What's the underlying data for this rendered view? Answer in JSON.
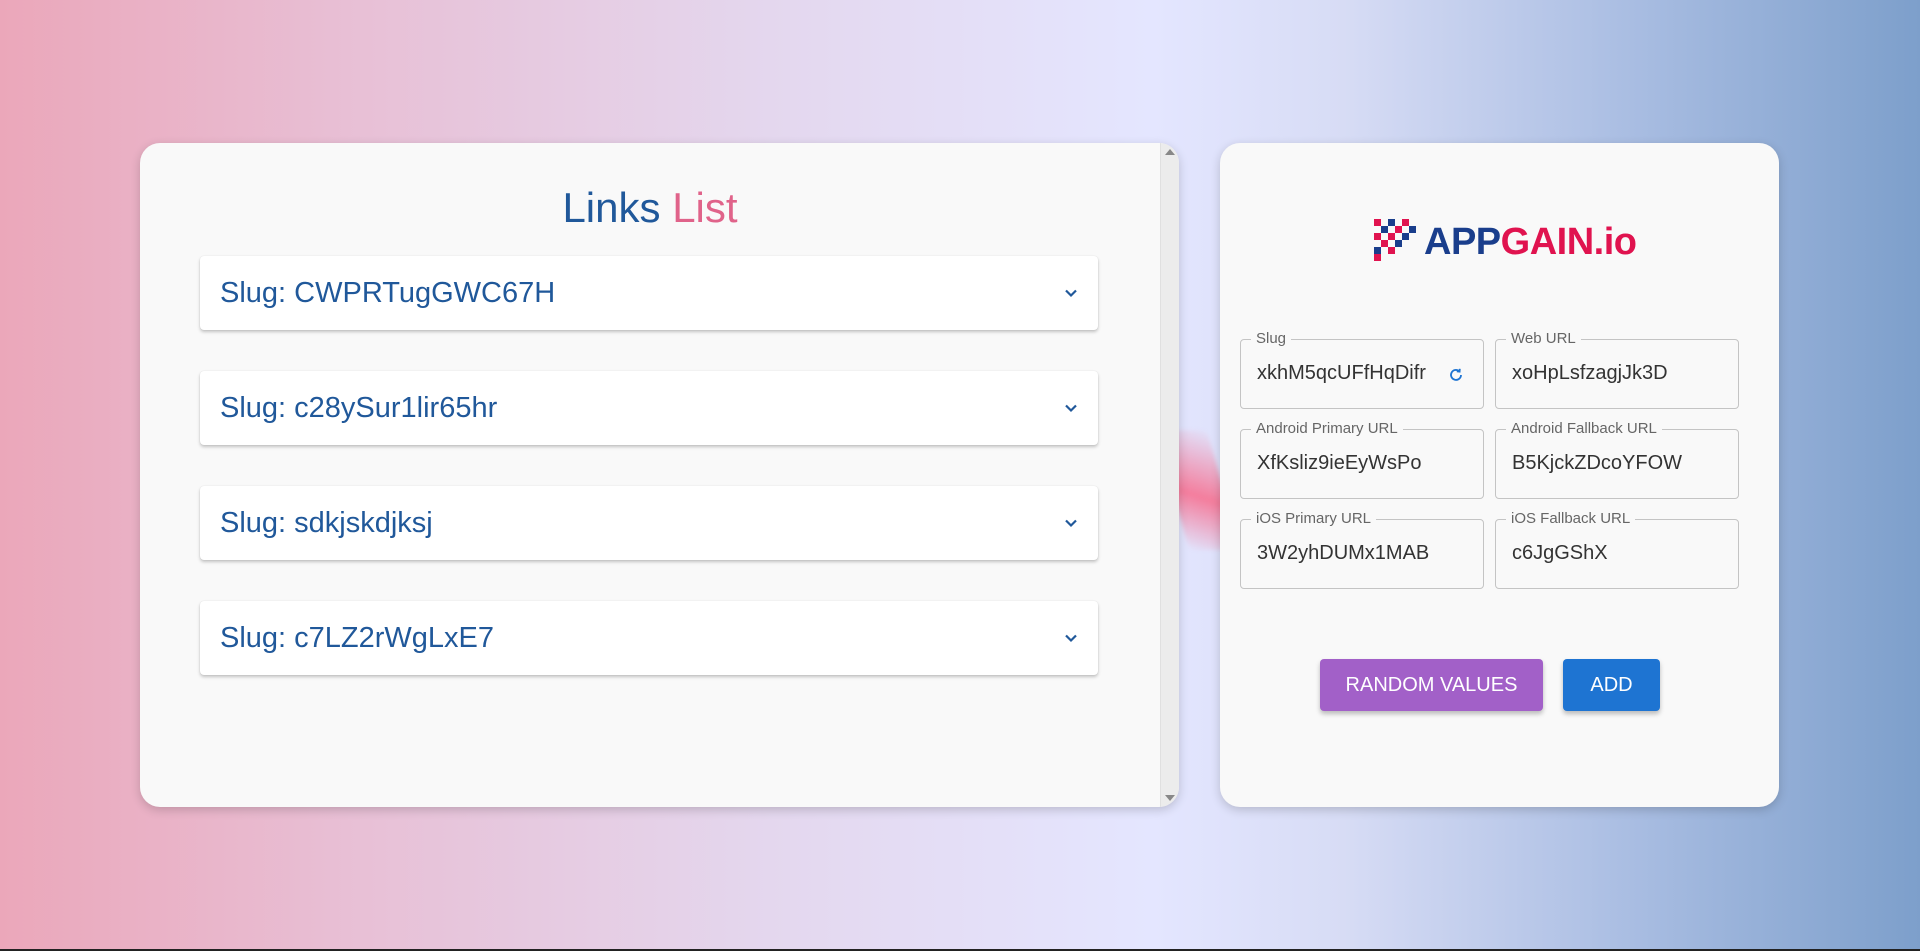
{
  "links": {
    "title_part1": "Links",
    "title_part2": "List",
    "items": [
      {
        "label": "Slug: CWPRTugGWC67H"
      },
      {
        "label": "Slug: c28ySur1lir65hr"
      },
      {
        "label": "Slug: sdkjskdjksj"
      },
      {
        "label": "Slug: c7LZ2rWgLxE7"
      }
    ]
  },
  "logo": {
    "part1": "APP",
    "part2": "GAIN.io"
  },
  "form": {
    "fields": [
      {
        "label": "Slug",
        "value": "xkhM5qcUFfHqDifr"
      },
      {
        "label": "Web URL",
        "value": "xoHpLsfzagjJk3D"
      },
      {
        "label": "Android Primary URL",
        "value": "XfKsliz9ieEyWsPo"
      },
      {
        "label": "Android Fallback URL",
        "value": "B5KjckZDcoYFOW"
      },
      {
        "label": "iOS Primary URL",
        "value": "3W2yhDUMx1MAB"
      },
      {
        "label": "iOS Fallback URL",
        "value": "c6JgGShX"
      }
    ],
    "random_label": "RANDOM VALUES",
    "add_label": "ADD"
  },
  "colors": {
    "brand_blue": "#20589a",
    "brand_pink": "#e0638a",
    "random_button": "#a260c8",
    "add_button": "#1e74d2"
  },
  "icons": [
    "chevron-down-icon",
    "refresh-icon",
    "appgain-logo-icon"
  ]
}
